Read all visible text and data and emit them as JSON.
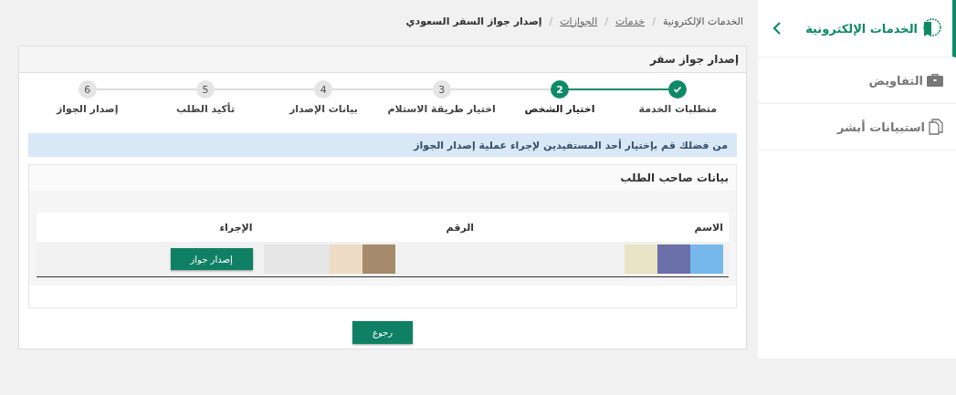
{
  "breadcrumb": [
    {
      "label": "الخدمات الإلكترونية",
      "kind": "plain"
    },
    {
      "separator": "/",
      "label": "خدمات",
      "kind": "link"
    },
    {
      "separator": "/",
      "label": "الجوازات",
      "kind": "link"
    },
    {
      "separator": "/",
      "label": "إصدار جواز السفر السعودي",
      "kind": "current"
    }
  ],
  "sidebar": {
    "title": "الخدمات الإلكترونية",
    "items": [
      {
        "label": "التفاويض",
        "kind": "briefcase"
      },
      {
        "label": "استبيانات أبشر",
        "kind": "documents"
      }
    ]
  },
  "panel": {
    "title": "إصدار جواز سفر"
  },
  "steps": [
    {
      "label": "متطلبات الخدمة",
      "done": true,
      "selected": false
    },
    {
      "number": "2",
      "label": "اختيار الشخص",
      "done": false,
      "selected": true
    },
    {
      "number": "3",
      "label": "اختيار طريقة الاستلام",
      "done": false,
      "selected": false
    },
    {
      "number": "4",
      "label": "بيانات الإصدار",
      "done": false,
      "selected": false
    },
    {
      "number": "5",
      "label": "تأكيد الطلب",
      "done": false,
      "selected": false
    },
    {
      "number": "6",
      "label": "إصدار الجواز",
      "done": false,
      "selected": false
    }
  ],
  "notice": "من فضلك قم بإختيار أحد المستفيدين لإجراء عملية إصدار الجواز",
  "applicant": {
    "title": "بيانات صاحب الطلب",
    "columns": [
      "الاسم",
      "الرقم",
      "الإجراء"
    ],
    "rows": [
      {
        "action": "إصدار جواز"
      }
    ]
  },
  "back_button": "رجوع"
}
